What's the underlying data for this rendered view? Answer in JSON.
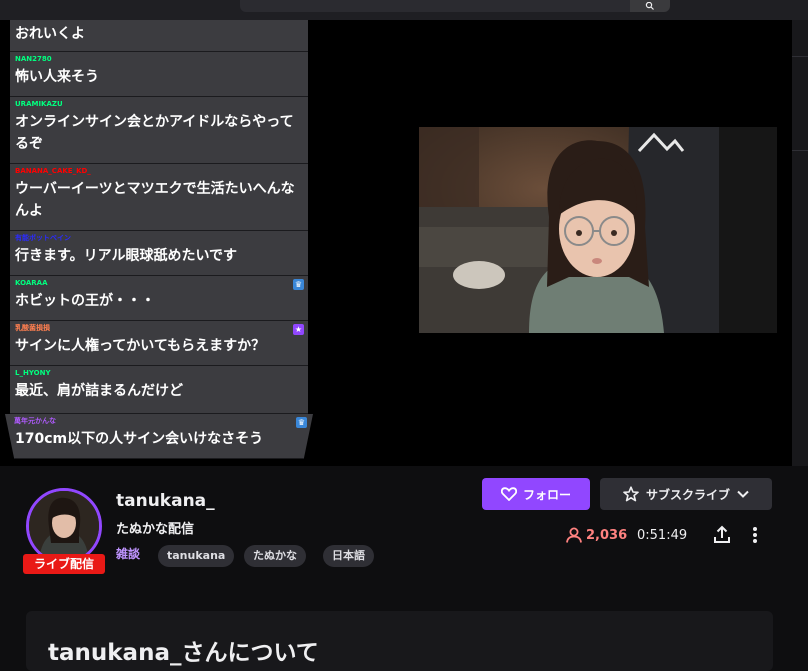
{
  "chat": {
    "messages": [
      {
        "user": "",
        "text": "おれいくよ",
        "color": "#ffffff"
      },
      {
        "user": "NAN2780",
        "text": "怖い人来そう",
        "color": "#00ff7f"
      },
      {
        "user": "URAMIKAZU",
        "text": "オンラインサイン会とかアイドルならやってるぞ",
        "color": "#00ff7f"
      },
      {
        "user": "BANANA_CAKE_KD_",
        "text": "ウーバーイーツとマツエクで生活たいへんなんよ",
        "color": "#ff0000"
      },
      {
        "user": "有能ボットベイン",
        "text": "行きます。リアル眼球舐めたいです",
        "color": "#0000ff"
      },
      {
        "user": "KOARAA",
        "text": "ホビットの王が・・・",
        "color": "#00ff7f",
        "badge": "crown-icon"
      },
      {
        "user": "乳酸菌損損",
        "text": "サインに人権ってかいてもらえますか？",
        "color": "#ff7f50",
        "badge": "star-icon"
      },
      {
        "user": "L_HYONY",
        "text": "最近、肩が詰まるんだけど",
        "color": "#00ff7f"
      },
      {
        "user": "萬年元かんな",
        "text": "170cm以下の人サイン会いけなさそう",
        "color": "#8a2be2",
        "badge": "crown-icon"
      }
    ]
  },
  "channel": {
    "name": "tanukana_",
    "title": "たぬかな配信",
    "live_label": "ライブ配信",
    "category": "雑談",
    "tags": [
      "tanukana",
      "たぬかな",
      "日本語"
    ],
    "follow_label": "フォロー",
    "subscribe_label": "サブスクライブ",
    "viewers": "2,036",
    "uptime": "0:51:49"
  },
  "about": {
    "title": "tanukana_さんについて"
  },
  "colors": {
    "accent": "#9147ff",
    "live": "#e91916",
    "viewers": "#ff8280"
  }
}
